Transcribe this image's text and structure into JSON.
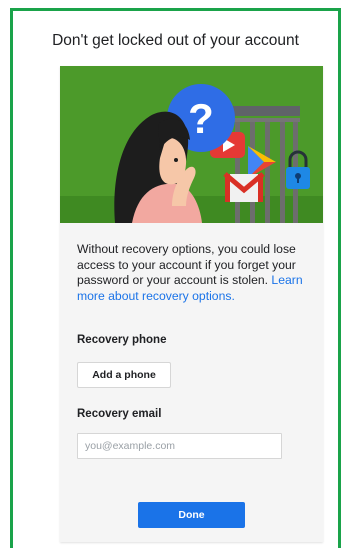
{
  "page": {
    "headline": "Don't get locked out of your account"
  },
  "illustration": {
    "question_mark": "?",
    "background_color": "#4c9a2a",
    "bubble_color": "#2f6de6"
  },
  "intro": {
    "text": "Without recovery options, you could lose access to your account if you forget your password or your account is stolen.",
    "learn_more": "Learn more about recovery options."
  },
  "recovery_phone": {
    "label": "Recovery phone",
    "button": "Add a phone"
  },
  "recovery_email": {
    "label": "Recovery email",
    "placeholder": "you@example.com",
    "value": ""
  },
  "actions": {
    "done": "Done"
  },
  "colors": {
    "frame_border": "#1aa34a",
    "accent": "#1a73e8",
    "card_bg": "#f5f5f5"
  }
}
